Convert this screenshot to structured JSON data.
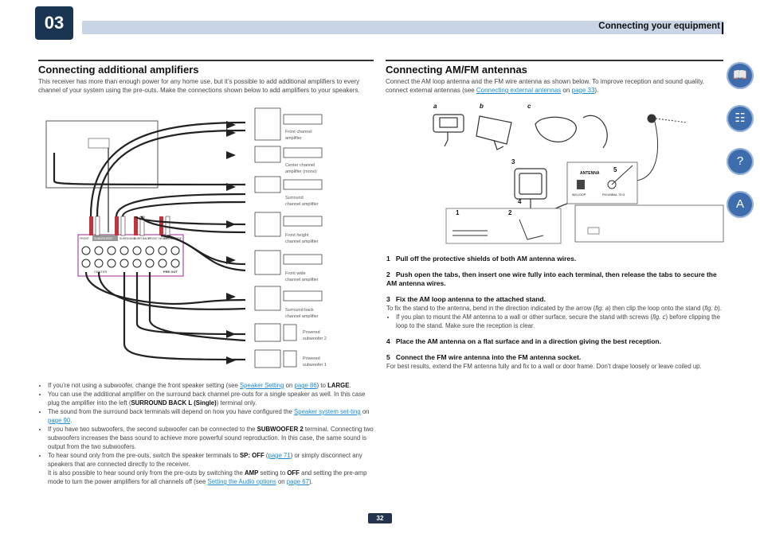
{
  "header": {
    "chapter": "03",
    "title": "Connecting your equipment"
  },
  "left": {
    "title": "Connecting additional amplifiers",
    "intro": "This receiver has more than enough power for any home use, but it’s possible to add additional amplifiers to every channel of your system using the pre-outs. Make the connections shown below to add amplifiers to your speakers.",
    "amps": [
      {
        "label_1": "Front channel",
        "label_2": "amplifier"
      },
      {
        "label_1": "Center channel",
        "label_2": "amplifier (mono)"
      },
      {
        "label_1": "Surround",
        "label_2": "channel amplifier"
      },
      {
        "label_1": "Front height",
        "label_2": "channel amplifier"
      },
      {
        "label_1": "Front wide",
        "label_2": "channel amplifier"
      },
      {
        "label_1": "Surround back",
        "label_2": "channel amplifier"
      },
      {
        "label_1": "Powered",
        "label_2": "subwoofer 2"
      },
      {
        "label_1": "Powered",
        "label_2": "subwoofer 1"
      }
    ],
    "amp_input_label": "ANALOG INPUT",
    "panel": {
      "labels": [
        "FRONT",
        "SUBWOOFER",
        "SURROUND",
        "SURR BACK",
        "FRONT HEIGHT",
        "FRONT WIDE"
      ],
      "center": "CENTER",
      "preout": "PRE OUT"
    },
    "bullets": {
      "b1": {
        "t1": "If you’re not using a subwoofer, change the front speaker setting (see ",
        "l1": "Speaker Setting",
        "t2": " on ",
        "l2": "page 86",
        "t3": ") to ",
        "b": "LARGE",
        "t4": "."
      },
      "b2": {
        "t1": "You can use the additional amplifier on the surround back channel pre-outs for a single speaker as well. In this case plug the amplifier into the left (",
        "b": "SURROUND BACK L (Single)",
        "t2": ") terminal only."
      },
      "b3": {
        "t1": "The sound from the surround back terminals will depend on how you have configured the ",
        "l1": "Speaker system set-ting",
        "t2": " on ",
        "l2": "page 90",
        "t3": "."
      },
      "b4": {
        "t1": "If you have two subwoofers, the second subwoofer can be connected to the ",
        "b": "SUBWOOFER 2",
        "t2": " terminal. Connecting two subwoofers increases the bass sound to achieve more powerful sound reproduction. In this case, the same sound is output from the two subwoofers."
      },
      "b5": {
        "t1": "To hear sound only from the pre-outs, switch the speaker terminals to ",
        "b1": "SP: OFF",
        "t2": " (",
        "l1": "page 71",
        "t3": ") or simply disconnect any speakers that are connected directly to the receiver.",
        "t4": "It is also possible to hear sound only from the pre-outs by switching the ",
        "b2": "AMP",
        "t5": " setting to ",
        "b3": "OFF",
        "t6": " and setting the pre-amp mode to turn the power amplifiers for all channels off (see ",
        "l2": "Setting the Audio options",
        "t7": " on ",
        "l3": "page 67",
        "t8": ")."
      }
    }
  },
  "right": {
    "title": "Connecting AM/FM antennas",
    "intro_1": "Connect the AM loop antenna and the FM wire antenna as shown below. To improve reception and sound quality, connect external antennas (see ",
    "intro_link_1": "Connecting external antennas",
    "intro_2": " on ",
    "intro_link_2": "page 33",
    "intro_3": ").",
    "fig_labels": {
      "a": "a",
      "b": "b",
      "c": "c",
      "n1": "1",
      "n2": "2",
      "n3": "3",
      "n4": "4",
      "n5": "5"
    },
    "antenna_panel": {
      "title": "ANTENNA",
      "am": "AM LOOP",
      "fm": "FM UNBAL 75 Ω"
    },
    "steps": [
      {
        "num": "1",
        "title": "Pull off the protective shields of both AM antenna wires."
      },
      {
        "num": "2",
        "title": "Push open the tabs, then insert one wire fully into each terminal, then release the tabs to secure the AM antenna wires."
      },
      {
        "num": "3",
        "title": "Fix the AM loop antenna to the attached stand."
      },
      {
        "num": "4",
        "title": "Place the AM antenna on a flat surface and in a direction giving the best reception."
      },
      {
        "num": "5",
        "title": "Connect the FM wire antenna into the FM antenna socket."
      }
    ],
    "step3_text_1": "To fix the stand to the antenna, bend in the direction indicated by the arrow (",
    "step3_fig_a": "fig. a",
    "step3_text_2": ") then clip the loop onto the stand (",
    "step3_fig_b": "fig. b",
    "step3_text_3": ").",
    "step3_bullet_1": "If you plan to mount the AM antenna to a wall or other surface, secure the stand with screws (",
    "step3_bullet_fig": "fig. c",
    "step3_bullet_2": ") before clipping the loop to the stand. Make sure the reception is clear.",
    "step5_text": "For best results, extend the FM antenna fully and fix to a wall or door frame. Don’t drape loosely or leave coiled up."
  },
  "page_number": "32",
  "side_icons": [
    "book-icon",
    "remote-icon",
    "help-icon",
    "glossary-icon"
  ]
}
